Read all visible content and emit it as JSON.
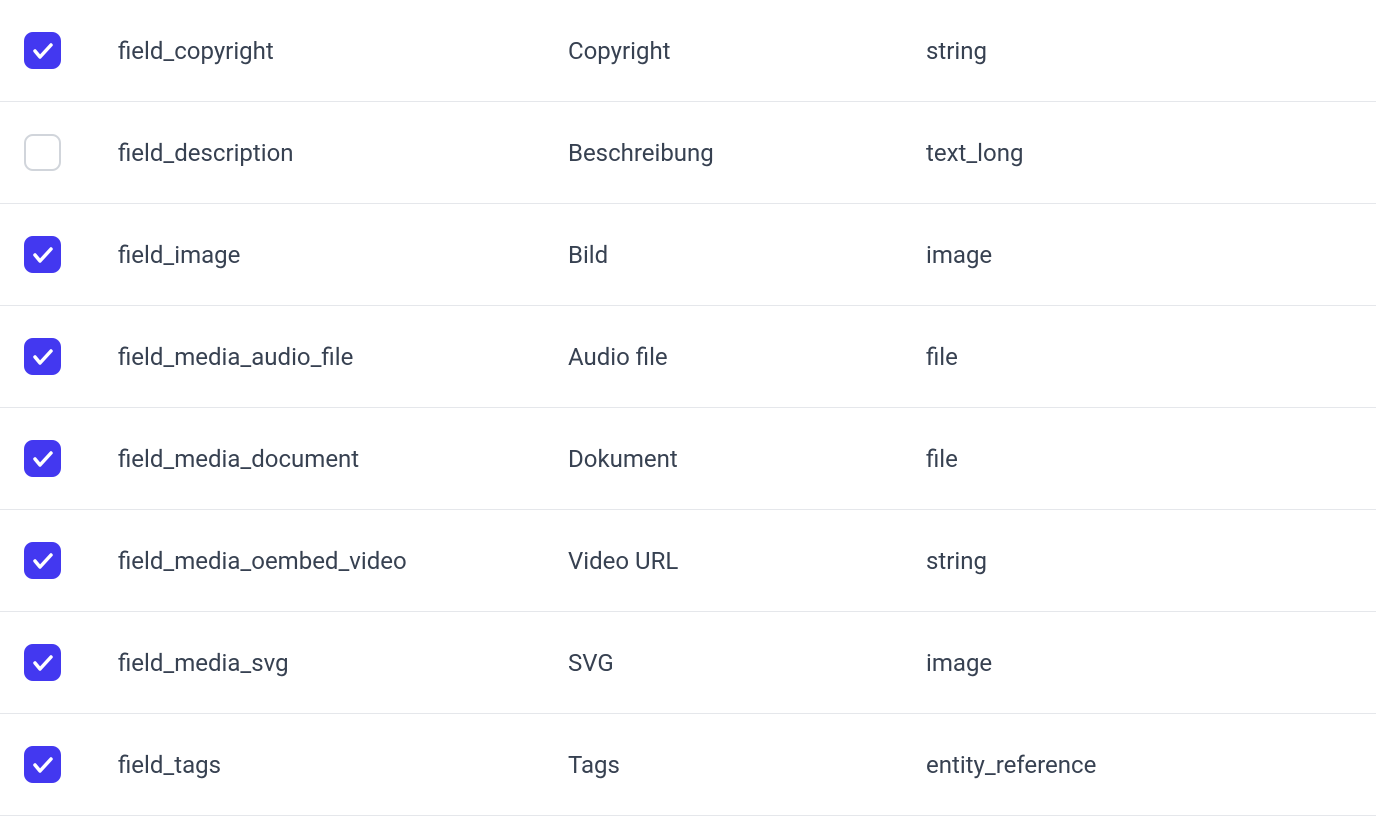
{
  "fields": [
    {
      "checked": true,
      "name": "field_copyright",
      "label": "Copyright",
      "type": "string"
    },
    {
      "checked": false,
      "name": "field_description",
      "label": "Beschreibung",
      "type": "text_long"
    },
    {
      "checked": true,
      "name": "field_image",
      "label": "Bild",
      "type": "image"
    },
    {
      "checked": true,
      "name": "field_media_audio_file",
      "label": "Audio file",
      "type": "file"
    },
    {
      "checked": true,
      "name": "field_media_document",
      "label": "Dokument",
      "type": "file"
    },
    {
      "checked": true,
      "name": "field_media_oembed_video",
      "label": "Video URL",
      "type": "string"
    },
    {
      "checked": true,
      "name": "field_media_svg",
      "label": "SVG",
      "type": "image"
    },
    {
      "checked": true,
      "name": "field_tags",
      "label": "Tags",
      "type": "entity_reference"
    }
  ]
}
